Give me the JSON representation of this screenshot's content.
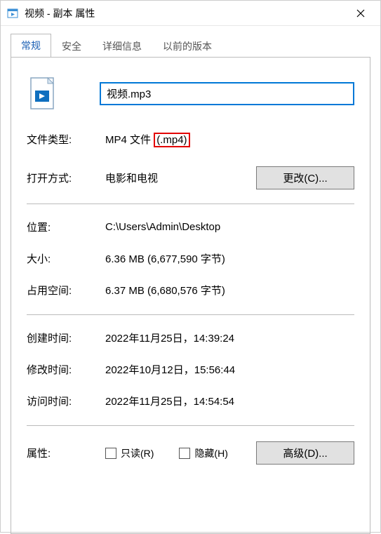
{
  "window": {
    "title": "视频 - 副本 属性"
  },
  "tabs": {
    "general": "常规",
    "security": "安全",
    "details": "详细信息",
    "previous": "以前的版本"
  },
  "file": {
    "name_input": "视频.mp3"
  },
  "fields": {
    "type_label": "文件类型:",
    "type_value": "MP4 文件 ",
    "type_ext": "(.mp4)",
    "openwith_label": "打开方式:",
    "openwith_value": "电影和电视",
    "change_btn": "更改(C)...",
    "location_label": "位置:",
    "location_value": "C:\\Users\\Admin\\Desktop",
    "size_label": "大小:",
    "size_value": "6.36 MB (6,677,590 字节)",
    "sizeondisk_label": "占用空间:",
    "sizeondisk_value": "6.37 MB (6,680,576 字节)",
    "created_label": "创建时间:",
    "created_value": "2022年11月25日，14:39:24",
    "modified_label": "修改时间:",
    "modified_value": "2022年10月12日，15:56:44",
    "accessed_label": "访问时间:",
    "accessed_value": "2022年11月25日，14:54:54",
    "attributes_label": "属性:",
    "readonly_label": "只读(R)",
    "hidden_label": "隐藏(H)",
    "advanced_btn": "高级(D)..."
  }
}
